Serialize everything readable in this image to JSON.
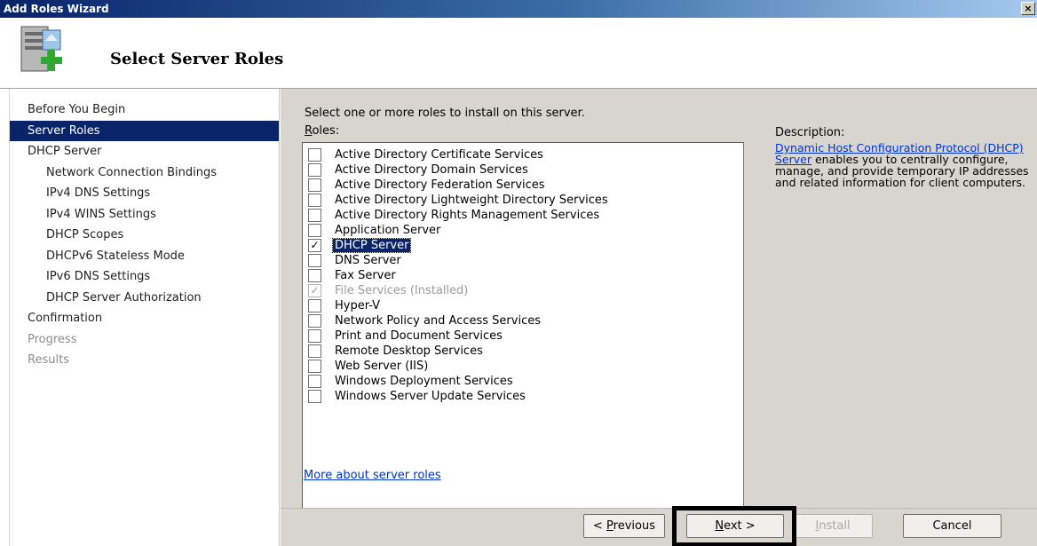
{
  "window": {
    "title": "Add Roles Wizard",
    "close_glyph": "×"
  },
  "header": {
    "title": "Select Server Roles",
    "icon": "server-add-icon"
  },
  "nav": {
    "items": [
      {
        "label": "Before You Begin",
        "level": 0,
        "state": "normal"
      },
      {
        "label": "Server Roles",
        "level": 0,
        "state": "active"
      },
      {
        "label": "DHCP Server",
        "level": 0,
        "state": "normal"
      },
      {
        "label": "Network Connection Bindings",
        "level": 1,
        "state": "normal"
      },
      {
        "label": "IPv4 DNS Settings",
        "level": 1,
        "state": "normal"
      },
      {
        "label": "IPv4 WINS Settings",
        "level": 1,
        "state": "normal"
      },
      {
        "label": "DHCP Scopes",
        "level": 1,
        "state": "normal"
      },
      {
        "label": "DHCPv6 Stateless Mode",
        "level": 1,
        "state": "normal"
      },
      {
        "label": "IPv6 DNS Settings",
        "level": 1,
        "state": "normal"
      },
      {
        "label": "DHCP Server Authorization",
        "level": 1,
        "state": "normal"
      },
      {
        "label": "Confirmation",
        "level": 0,
        "state": "normal"
      },
      {
        "label": "Progress",
        "level": 0,
        "state": "disabled"
      },
      {
        "label": "Results",
        "level": 0,
        "state": "disabled"
      }
    ]
  },
  "main": {
    "instruction": "Select one or more roles to install on this server.",
    "roles_label_first": "R",
    "roles_label_rest": "oles:",
    "roles": [
      {
        "label": "Active Directory Certificate Services",
        "checked": false
      },
      {
        "label": "Active Directory Domain Services",
        "checked": false
      },
      {
        "label": "Active Directory Federation Services",
        "checked": false
      },
      {
        "label": "Active Directory Lightweight Directory Services",
        "checked": false
      },
      {
        "label": "Active Directory Rights Management Services",
        "checked": false
      },
      {
        "label": "Application Server",
        "checked": false
      },
      {
        "label": "DHCP Server",
        "checked": true,
        "selected": true
      },
      {
        "label": "DNS Server",
        "checked": false
      },
      {
        "label": "Fax Server",
        "checked": false
      },
      {
        "label": "File Services  (Installed)",
        "checked": true,
        "installed": true
      },
      {
        "label": "Hyper-V",
        "checked": false
      },
      {
        "label": "Network Policy and Access Services",
        "checked": false
      },
      {
        "label": "Print and Document Services",
        "checked": false
      },
      {
        "label": "Remote Desktop Services",
        "checked": false
      },
      {
        "label": "Web Server (IIS)",
        "checked": false
      },
      {
        "label": "Windows Deployment Services",
        "checked": false
      },
      {
        "label": "Windows Server Update Services",
        "checked": false
      }
    ],
    "more_link": "More about server roles",
    "description": {
      "label": "Description:",
      "link_text": "Dynamic Host Configuration Protocol (DHCP) Server",
      "body": " enables you to centrally configure, manage, and provide temporary IP addresses and related information for client computers."
    }
  },
  "footer": {
    "prev_prefix": "< ",
    "prev_underlined": "P",
    "prev_rest": "revious",
    "next_underlined": "N",
    "next_rest": "ext >",
    "install_underlined": "I",
    "install_rest": "nstall",
    "cancel_label": "Cancel"
  },
  "check_glyph": "✓"
}
